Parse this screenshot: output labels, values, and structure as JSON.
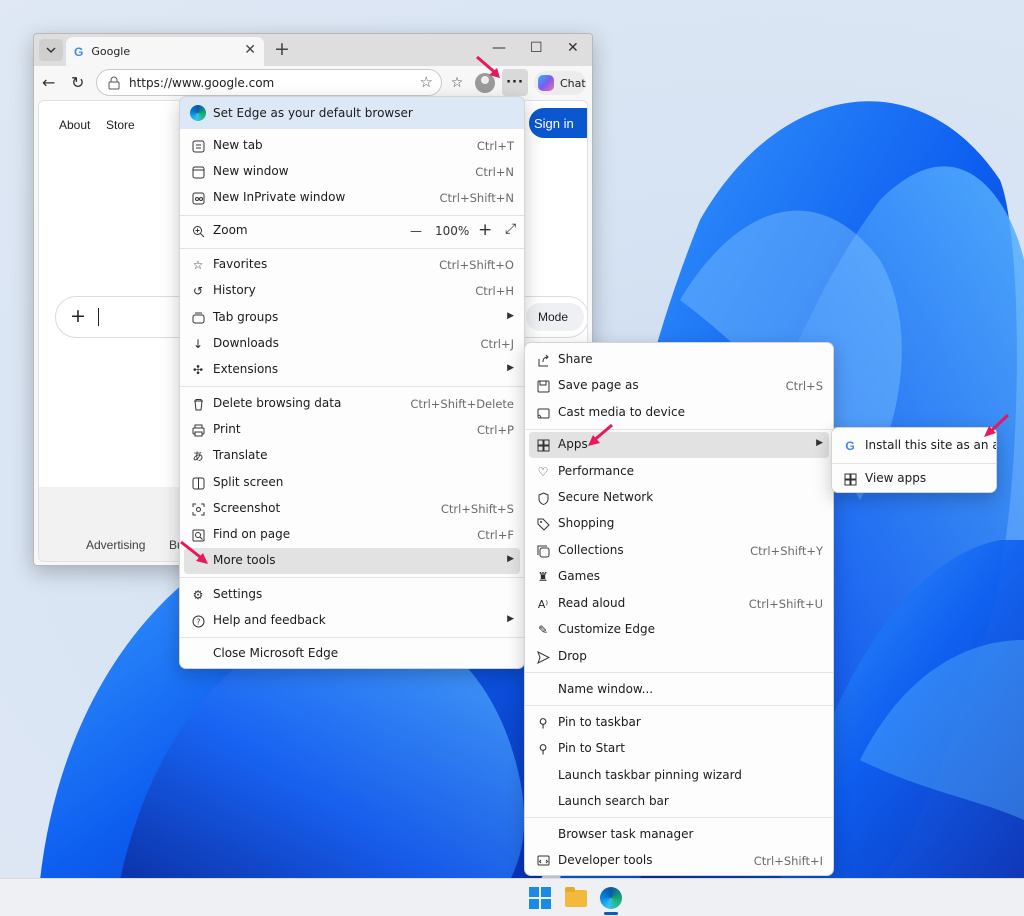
{
  "browser": {
    "tab": {
      "title": "Google"
    },
    "address": {
      "url": "https://www.google.com"
    },
    "chat_label": "Chat",
    "more_label": "···"
  },
  "page": {
    "links": {
      "about": "About",
      "store": "Store"
    },
    "sign_in": "Sign in",
    "mode_label": "Mode",
    "footer": {
      "advertising": "Advertising",
      "business_partial": "Bu"
    }
  },
  "main_menu": {
    "banner": "Set Edge as your default browser",
    "items": [
      {
        "label": "New tab",
        "shortcut": "Ctrl+T",
        "icon": "new-tab-icon"
      },
      {
        "label": "New window",
        "shortcut": "Ctrl+N",
        "icon": "window-icon"
      },
      {
        "label": "New InPrivate window",
        "shortcut": "Ctrl+Shift+N",
        "icon": "inprivate-icon"
      },
      {
        "label": "Zoom",
        "value": "100%",
        "icon": "zoom-icon"
      },
      {
        "label": "Favorites",
        "shortcut": "Ctrl+Shift+O",
        "icon": "favorites-icon"
      },
      {
        "label": "History",
        "shortcut": "Ctrl+H",
        "icon": "history-icon"
      },
      {
        "label": "Tab groups",
        "icon": "tab-groups-icon"
      },
      {
        "label": "Downloads",
        "shortcut": "Ctrl+J",
        "icon": "download-icon"
      },
      {
        "label": "Extensions",
        "icon": "extensions-icon"
      },
      {
        "label": "Delete browsing data",
        "shortcut": "Ctrl+Shift+Delete",
        "icon": "trash-icon"
      },
      {
        "label": "Print",
        "shortcut": "Ctrl+P",
        "icon": "print-icon"
      },
      {
        "label": "Translate",
        "icon": "translate-icon"
      },
      {
        "label": "Split screen",
        "icon": "split-screen-icon"
      },
      {
        "label": "Screenshot",
        "shortcut": "Ctrl+Shift+S",
        "icon": "screenshot-icon"
      },
      {
        "label": "Find on page",
        "shortcut": "Ctrl+F",
        "icon": "find-icon"
      },
      {
        "label": "More tools",
        "icon": "more-tools-icon"
      },
      {
        "label": "Settings",
        "icon": "gear-icon"
      },
      {
        "label": "Help and feedback",
        "icon": "help-icon"
      },
      {
        "label": "Close Microsoft Edge"
      }
    ]
  },
  "more_tools_menu": {
    "items": [
      {
        "label": "Share",
        "icon": "share-icon"
      },
      {
        "label": "Save page as",
        "shortcut": "Ctrl+S",
        "icon": "save-icon"
      },
      {
        "label": "Cast media to device",
        "icon": "cast-icon"
      },
      {
        "label": "Apps",
        "icon": "apps-icon"
      },
      {
        "label": "Performance",
        "icon": "performance-icon"
      },
      {
        "label": "Secure Network",
        "icon": "shield-icon"
      },
      {
        "label": "Shopping",
        "icon": "tag-icon"
      },
      {
        "label": "Collections",
        "shortcut": "Ctrl+Shift+Y",
        "icon": "collections-icon"
      },
      {
        "label": "Games",
        "icon": "games-icon"
      },
      {
        "label": "Read aloud",
        "shortcut": "Ctrl+Shift+U",
        "icon": "read-aloud-icon"
      },
      {
        "label": "Customize Edge",
        "icon": "pencil-icon"
      },
      {
        "label": "Drop",
        "icon": "send-icon"
      },
      {
        "label": "Name window..."
      },
      {
        "label": "Pin to taskbar",
        "icon": "pin-icon"
      },
      {
        "label": "Pin to Start",
        "icon": "pin-icon"
      },
      {
        "label": "Launch taskbar pinning wizard"
      },
      {
        "label": "Launch search bar"
      },
      {
        "label": "Browser task manager"
      },
      {
        "label": "Developer tools",
        "shortcut": "Ctrl+Shift+I",
        "icon": "devtools-icon"
      }
    ]
  },
  "apps_menu": {
    "items": [
      {
        "label": "Install this site as an app",
        "icon": "google-icon"
      },
      {
        "label": "View apps",
        "icon": "apps-icon"
      }
    ]
  },
  "colors": {
    "accent_blue": "#0b57d0",
    "annotation_arrow": "#e8185f",
    "highlight": "#e2e2e2"
  }
}
